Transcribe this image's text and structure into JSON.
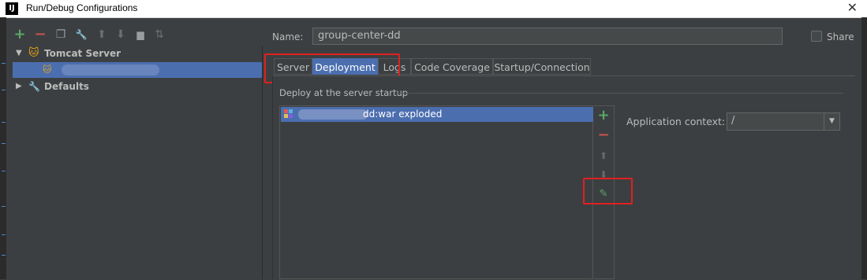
{
  "window": {
    "title": "Run/Debug Configurations",
    "app_icon": "IJ",
    "close_glyph": "✕"
  },
  "toolbar": {
    "icons": [
      "add-icon",
      "remove-icon",
      "copy-icon",
      "wrench-icon",
      "move-up-icon",
      "move-down-icon",
      "folder-icon",
      "sort-icon"
    ],
    "glyphs": {
      "add": "+",
      "remove": "−",
      "copy": "❐",
      "wrench": "🔧",
      "up": "⬆",
      "down": "⬇",
      "folder": "▆",
      "sort": "⇅"
    }
  },
  "tree": {
    "groups": [
      {
        "label": "Tomcat Server",
        "expanded": true,
        "arrow": "▼",
        "icon": "tomcat-icon"
      },
      {
        "label": "Defaults",
        "expanded": false,
        "arrow": "▶",
        "icon": "defaults-wrench-icon"
      }
    ],
    "selected_child_icon": "tomcat-config-icon"
  },
  "name_field": {
    "label": "Name:",
    "value": "group-center-dd"
  },
  "share": {
    "label": "Share",
    "checked": false
  },
  "tabs": [
    {
      "label": "Server",
      "active": false
    },
    {
      "label": "Deployment",
      "active": true
    },
    {
      "label": "Logs",
      "active": false
    },
    {
      "label": "Code Coverage",
      "active": false
    },
    {
      "label": "Startup/Connection",
      "active": false
    }
  ],
  "deployment": {
    "group_title": "Deploy at the server startup",
    "artifacts": [
      {
        "label": "dd:war exploded",
        "selected": true,
        "icon": "war-artifact-icon"
      }
    ],
    "side_toolbar": {
      "icons": [
        "add-icon",
        "remove-icon",
        "move-up-icon",
        "move-down-icon",
        "edit-pencil-icon"
      ],
      "glyphs": {
        "add": "+",
        "remove": "−",
        "up": "⬆",
        "down": "⬇",
        "edit": "✎"
      }
    },
    "application_context": {
      "label": "Application context:",
      "value": "/",
      "dropdown_glyph": "▼"
    }
  },
  "colors": {
    "background": "#3c3f41",
    "selection": "#4b6eaf",
    "text": "#bbbbbb",
    "highlight_box": "#e02020",
    "add_green": "#59a869",
    "remove_red": "#c75450"
  }
}
